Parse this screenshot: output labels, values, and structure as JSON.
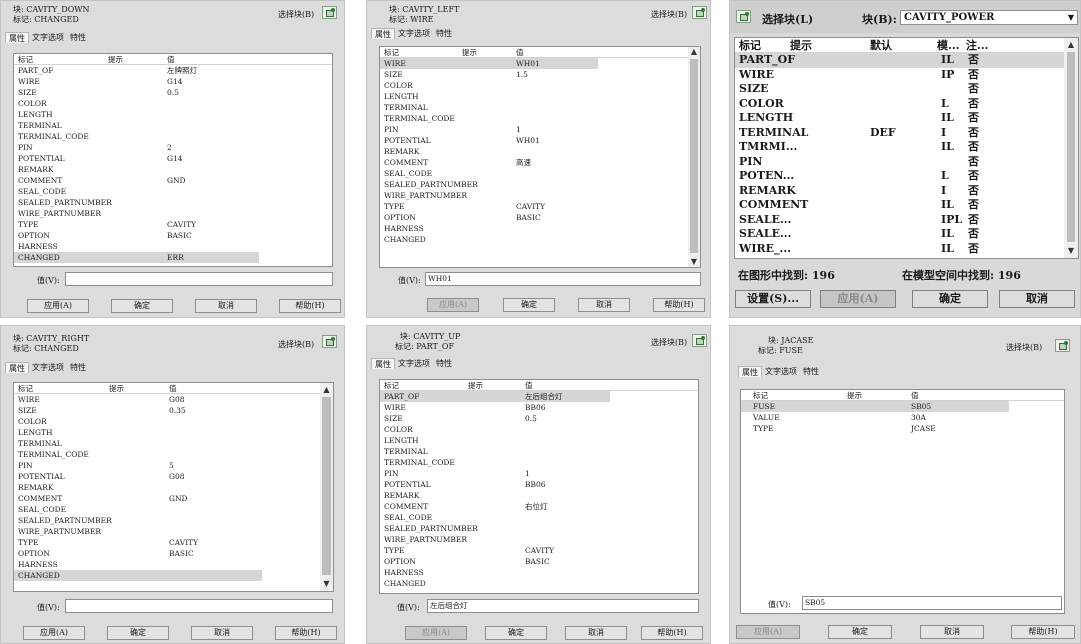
{
  "common": {
    "select_block": "选择块(B)",
    "value_label": "值(V):",
    "apply": "应用(A)",
    "ok": "确定",
    "cancel": "取消",
    "help": "帮助(H)",
    "tab_attr": "属性",
    "tab_text": "文字选项",
    "tab_props": "特性",
    "col_tag": "标记",
    "col_prompt": "提示",
    "col_value": "值",
    "select_icon": "select-objects-icon"
  },
  "p1": {
    "block": "块: CAVITY_DOWN",
    "tag": "标记: CHANGED",
    "value": "",
    "rows": [
      {
        "tag": "PART_OF",
        "value": "左牌照灯"
      },
      {
        "tag": "WIRE",
        "value": "G14"
      },
      {
        "tag": "SIZE",
        "value": "0.5"
      },
      {
        "tag": "COLOR",
        "value": ""
      },
      {
        "tag": "LENGTH",
        "value": ""
      },
      {
        "tag": "TERMINAL",
        "value": ""
      },
      {
        "tag": "TERMINAL_CODE",
        "value": ""
      },
      {
        "tag": "PIN",
        "value": "2"
      },
      {
        "tag": "POTENTIAL",
        "value": "G14"
      },
      {
        "tag": "REMARK",
        "value": ""
      },
      {
        "tag": "COMMENT",
        "value": "GND"
      },
      {
        "tag": "SEAL_CODE",
        "value": ""
      },
      {
        "tag": "SEALED_PARTNUMBER",
        "value": ""
      },
      {
        "tag": "WIRE_PARTNUMBER",
        "value": ""
      },
      {
        "tag": "TYPE",
        "value": "CAVITY"
      },
      {
        "tag": "OPTION",
        "value": "BASIC"
      },
      {
        "tag": "HARNESS",
        "value": ""
      },
      {
        "tag": "CHANGED",
        "value": "ERR",
        "selected": true
      }
    ]
  },
  "p2": {
    "block": "块: CAVITY_LEFT",
    "tag": "标记: WIRE",
    "value": "WH01",
    "rows": [
      {
        "tag": "WIRE",
        "value": "WH01",
        "selected": true
      },
      {
        "tag": "SIZE",
        "value": "1.5"
      },
      {
        "tag": "COLOR",
        "value": ""
      },
      {
        "tag": "LENGTH",
        "value": ""
      },
      {
        "tag": "TERMINAL",
        "value": ""
      },
      {
        "tag": "TERMINAL_CODE",
        "value": ""
      },
      {
        "tag": "PIN",
        "value": "1"
      },
      {
        "tag": "POTENTIAL",
        "value": "WH01"
      },
      {
        "tag": "REMARK",
        "value": ""
      },
      {
        "tag": "COMMENT",
        "value": "高速"
      },
      {
        "tag": "SEAL_CODE",
        "value": ""
      },
      {
        "tag": "SEALED_PARTNUMBER",
        "value": ""
      },
      {
        "tag": "WIRE_PARTNUMBER",
        "value": ""
      },
      {
        "tag": "TYPE",
        "value": "CAVITY"
      },
      {
        "tag": "OPTION",
        "value": "BASIC"
      },
      {
        "tag": "HARNESS",
        "value": ""
      },
      {
        "tag": "CHANGED",
        "value": ""
      }
    ]
  },
  "p3": {
    "select_block": "选择块(L)",
    "block_label": "块(B):",
    "block_value": "CAVITY_POWER",
    "col_tag": "标记",
    "col_prompt": "提示",
    "col_default": "默认",
    "col_mode": "模...",
    "col_note": "注...",
    "rows": [
      {
        "tag": "PART_OF",
        "default": "",
        "mode": "IL",
        "note": "否",
        "selected": true
      },
      {
        "tag": "WIRE",
        "default": "",
        "mode": "IP",
        "note": "否"
      },
      {
        "tag": "SIZE",
        "default": "",
        "mode": "",
        "note": "否"
      },
      {
        "tag": "COLOR",
        "default": "",
        "mode": "L",
        "note": "否"
      },
      {
        "tag": "LENGTH",
        "default": "",
        "mode": "IL",
        "note": "否"
      },
      {
        "tag": "TERMINAL",
        "default": "DEF",
        "mode": "I",
        "note": "否"
      },
      {
        "tag": "TMRMI...",
        "default": "",
        "mode": "IL",
        "note": "否"
      },
      {
        "tag": "PIN",
        "default": "",
        "mode": "",
        "note": "否"
      },
      {
        "tag": "POTEN...",
        "default": "",
        "mode": "L",
        "note": "否"
      },
      {
        "tag": "REMARK",
        "default": "",
        "mode": "I",
        "note": "否"
      },
      {
        "tag": "COMMENT",
        "default": "",
        "mode": "IL",
        "note": "否"
      },
      {
        "tag": "SEALE...",
        "default": "",
        "mode": "IPL",
        "note": "否"
      },
      {
        "tag": "SEALE...",
        "default": "",
        "mode": "IL",
        "note": "否"
      },
      {
        "tag": "WIRE_...",
        "default": "",
        "mode": "IL",
        "note": "否"
      }
    ],
    "found_drawing": "在图形中找到: 196",
    "found_model": "在模型空间中找到: 196",
    "settings": "设置(S)...",
    "apply": "应用(A)",
    "ok": "确定",
    "cancel": "取消"
  },
  "p4": {
    "block": "块: CAVITY_RIGHT",
    "tag": "标记: CHANGED",
    "value": "",
    "rows": [
      {
        "tag": "WIRE",
        "value": "G08"
      },
      {
        "tag": "SIZE",
        "value": "0.35"
      },
      {
        "tag": "COLOR",
        "value": ""
      },
      {
        "tag": "LENGTH",
        "value": ""
      },
      {
        "tag": "TERMINAL",
        "value": ""
      },
      {
        "tag": "TERMINAL_CODE",
        "value": ""
      },
      {
        "tag": "PIN",
        "value": "5"
      },
      {
        "tag": "POTENTIAL",
        "value": "G08"
      },
      {
        "tag": "REMARK",
        "value": ""
      },
      {
        "tag": "COMMENT",
        "value": "GND"
      },
      {
        "tag": "SEAL_CODE",
        "value": ""
      },
      {
        "tag": "SEALED_PARTNUMBER",
        "value": ""
      },
      {
        "tag": "WIRE_PARTNUMBER",
        "value": ""
      },
      {
        "tag": "TYPE",
        "value": "CAVITY"
      },
      {
        "tag": "OPTION",
        "value": "BASIC"
      },
      {
        "tag": "HARNESS",
        "value": ""
      },
      {
        "tag": "CHANGED",
        "value": "",
        "selected": true
      }
    ]
  },
  "p5": {
    "block": "块: CAVITY_UP",
    "tag": "标记: PART_OF",
    "value": "左后组合灯",
    "rows": [
      {
        "tag": "PART_OF",
        "value": "左后组合灯",
        "selected": true
      },
      {
        "tag": "WIRE",
        "value": "BB06"
      },
      {
        "tag": "SIZE",
        "value": "0.5"
      },
      {
        "tag": "COLOR",
        "value": ""
      },
      {
        "tag": "LENGTH",
        "value": ""
      },
      {
        "tag": "TERMINAL",
        "value": ""
      },
      {
        "tag": "TERMINAL_CODE",
        "value": ""
      },
      {
        "tag": "PIN",
        "value": "1"
      },
      {
        "tag": "POTENTIAL",
        "value": "BB06"
      },
      {
        "tag": "REMARK",
        "value": ""
      },
      {
        "tag": "COMMENT",
        "value": "右位灯"
      },
      {
        "tag": "SEAL_CODE",
        "value": ""
      },
      {
        "tag": "SEALED_PARTNUMBER",
        "value": ""
      },
      {
        "tag": "WIRE_PARTNUMBER",
        "value": ""
      },
      {
        "tag": "TYPE",
        "value": "CAVITY"
      },
      {
        "tag": "OPTION",
        "value": "BASIC"
      },
      {
        "tag": "HARNESS",
        "value": ""
      },
      {
        "tag": "CHANGED",
        "value": ""
      }
    ]
  },
  "p6": {
    "block": "块: JACASE",
    "tag": "标记: FUSE",
    "value": "SB05",
    "rows": [
      {
        "tag": "FUSE",
        "value": "SB05",
        "selected": true
      },
      {
        "tag": "VALUE",
        "value": "30A"
      },
      {
        "tag": "TYPE",
        "value": "JCASE"
      }
    ]
  }
}
